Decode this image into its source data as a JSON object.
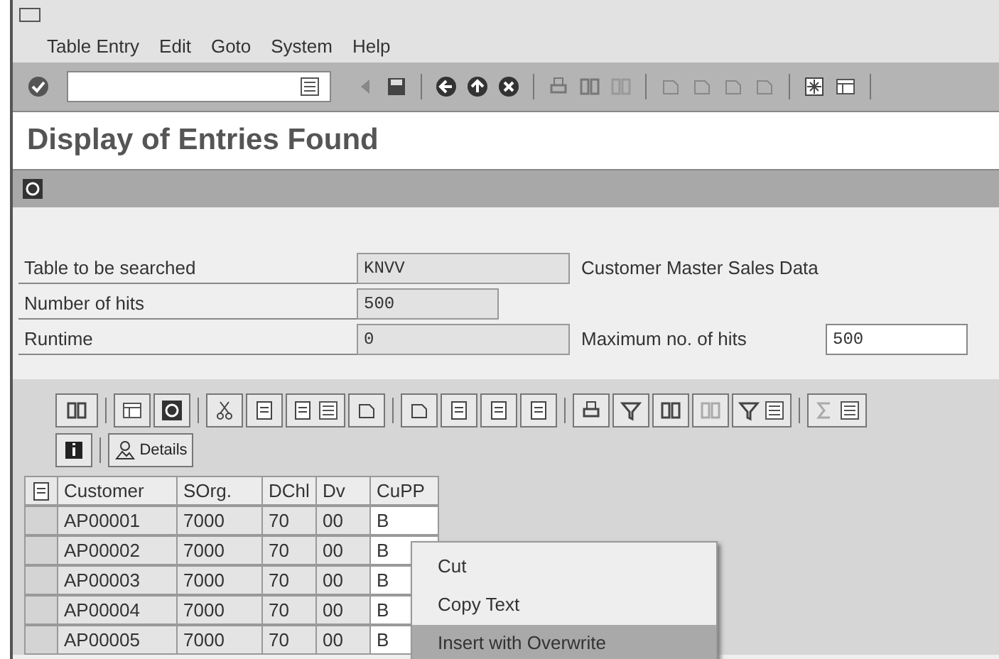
{
  "menu_bar": [
    {
      "label": "Table Entry"
    },
    {
      "label": "Edit"
    },
    {
      "label": "Goto"
    },
    {
      "label": "System"
    },
    {
      "label": "Help"
    }
  ],
  "screen_title": "Display of Entries Found",
  "fields": [
    {
      "label": "Table to be searched",
      "value": "KNVV",
      "description": "Customer Master Sales Data"
    },
    {
      "label": "Number of hits",
      "value": "500"
    },
    {
      "label": "Runtime",
      "value": "0",
      "extra_label": "Maximum no. of hits",
      "extra_value": "500"
    }
  ],
  "details_button": "Details",
  "table": {
    "columns": [
      "Customer",
      "SOrg.",
      "DChl",
      "Dv",
      "CuPP"
    ],
    "rows": [
      [
        "AP00001",
        "7000",
        "70",
        "00",
        "B"
      ],
      [
        "AP00002",
        "7000",
        "70",
        "00",
        "B"
      ],
      [
        "AP00003",
        "7000",
        "70",
        "00",
        "B"
      ],
      [
        "AP00004",
        "7000",
        "70",
        "00",
        "B"
      ],
      [
        "AP00005",
        "7000",
        "70",
        "00",
        "B"
      ]
    ]
  },
  "context_menu": [
    {
      "label": "Cut",
      "selected": false
    },
    {
      "label": "Copy Text",
      "selected": false
    },
    {
      "label": "Insert with Overwrite",
      "selected": true
    }
  ]
}
